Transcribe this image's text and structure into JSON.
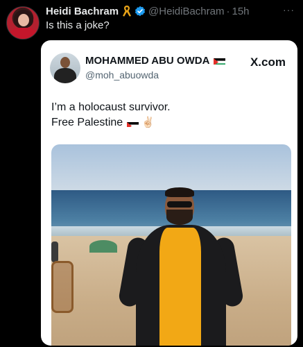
{
  "tweet": {
    "author_name": "Heidi Bachram",
    "author_handle": "@HeidiBachram",
    "separator": "·",
    "time": "15h",
    "text": "Is this a joke?",
    "more_label": "···",
    "badge_icons": [
      "ribbon-icon",
      "verified-badge-icon"
    ]
  },
  "quote": {
    "author_name": "MOHAMMED ABU OWDA",
    "author_handle": "@moh_abuowda",
    "source_label": "X.com",
    "text_line1": "I’m a holocaust survivor.",
    "text_line2": "Free Palestine",
    "emoji": "✌🏻",
    "flag_icon": "palestine-flag-icon"
  },
  "colors": {
    "background": "#000000",
    "card": "#ffffff",
    "verified_blue": "#1d9bf0",
    "muted_text": "#71767b",
    "ribbon_gold": "#e8a318"
  }
}
